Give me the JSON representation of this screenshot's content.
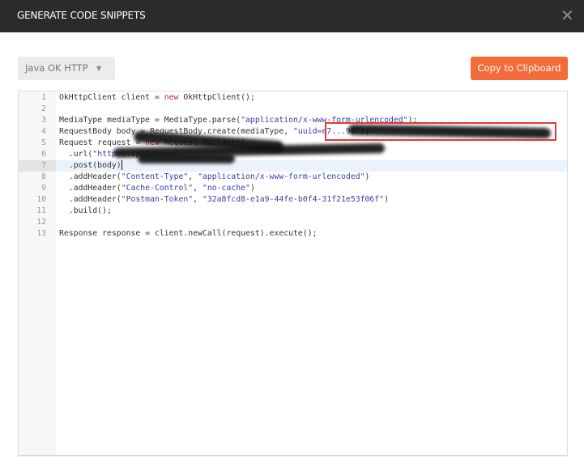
{
  "dialog": {
    "title": "GENERATE CODE SNIPPETS",
    "close_icon": "close-icon"
  },
  "toolbar": {
    "language": "Java OK HTTP",
    "copy_label": "Copy to Clipboard",
    "accent": "#f26b3a"
  },
  "editor": {
    "active_line": 7,
    "lines": [
      {
        "n": "1",
        "tokens": [
          [
            "OkHttpClient client = ",
            ""
          ],
          [
            "new",
            "kw"
          ],
          [
            " OkHttpClient();",
            ""
          ]
        ]
      },
      {
        "n": "2",
        "tokens": []
      },
      {
        "n": "3",
        "tokens": [
          [
            "MediaType mediaType = MediaType.parse(",
            ""
          ],
          [
            "\"application/x-www-form-urlencoded\"",
            "str"
          ],
          [
            ");",
            ""
          ]
        ]
      },
      {
        "n": "4",
        "tokens": [
          [
            "RequestBody body = RequestBody.create(mediaType, ",
            ""
          ],
          [
            "\"uuid=e7...98\"",
            "str"
          ],
          [
            ");",
            ""
          ]
        ]
      },
      {
        "n": "5",
        "tokens": [
          [
            "Request request = ",
            ""
          ],
          [
            "new",
            "kw"
          ],
          [
            " Request.Builder()",
            ""
          ]
        ]
      },
      {
        "n": "6",
        "tokens": [
          [
            "  .url(",
            ""
          ],
          [
            "\"http...sp\"",
            "str"
          ],
          [
            ")",
            ""
          ]
        ]
      },
      {
        "n": "7",
        "tokens": [
          [
            "  .post(body)",
            ""
          ]
        ]
      },
      {
        "n": "8",
        "tokens": [
          [
            "  .addHeader(",
            ""
          ],
          [
            "\"Content-Type\"",
            "str"
          ],
          [
            ", ",
            ""
          ],
          [
            "\"application/x-www-form-urlencoded\"",
            "str"
          ],
          [
            ")",
            ""
          ]
        ]
      },
      {
        "n": "9",
        "tokens": [
          [
            "  .addHeader(",
            ""
          ],
          [
            "\"Cache-Control\"",
            "str"
          ],
          [
            ", ",
            ""
          ],
          [
            "\"no-cache\"",
            "str"
          ],
          [
            ")",
            ""
          ]
        ]
      },
      {
        "n": "10",
        "tokens": [
          [
            "  .addHeader(",
            ""
          ],
          [
            "\"Postman-Token\"",
            "str"
          ],
          [
            ", ",
            ""
          ],
          [
            "\"32a8fcd8-e1a9-44fe-b0f4-31f21e53f06f\"",
            "str"
          ],
          [
            ")",
            ""
          ]
        ]
      },
      {
        "n": "11",
        "tokens": [
          [
            "  .build();",
            ""
          ]
        ]
      },
      {
        "n": "12",
        "tokens": []
      },
      {
        "n": "13",
        "tokens": [
          [
            "Response response = client.newCall(request).execute();",
            ""
          ]
        ]
      }
    ]
  }
}
